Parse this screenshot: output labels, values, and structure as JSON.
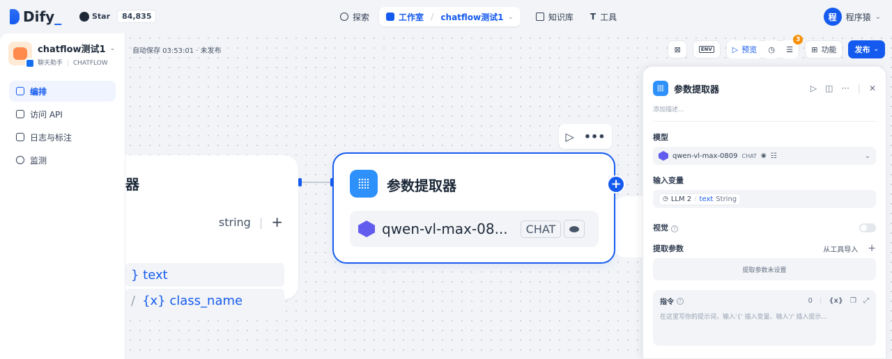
{
  "brand": {
    "logo_text": "Dify",
    "logo_suffix": "_",
    "github_label": "Star",
    "github_stars": "84,835"
  },
  "nav": {
    "explore": "探索",
    "studio": "工作室",
    "app_name": "chatflow测试1",
    "knowledge": "知识库",
    "tools": "工具"
  },
  "user": {
    "avatar_letter": "程",
    "name": "程序猿"
  },
  "sidebar": {
    "app_name": "chatflow测试1",
    "app_type": "聊天助手",
    "app_mode": "CHATFLOW",
    "items": [
      {
        "label": "编排",
        "active": true
      },
      {
        "label": "访问 API",
        "active": false
      },
      {
        "label": "日志与标注",
        "active": false
      },
      {
        "label": "监测",
        "active": false
      }
    ]
  },
  "canvas": {
    "autosave": "自动保存 03:53:01 · 未发布",
    "toolbar": {
      "preview": "预览",
      "notif_count": "3",
      "features": "功能",
      "publish": "发布",
      "env": "ENV"
    },
    "left_node": {
      "title_partial": "器",
      "output_type": "string",
      "var1": "} text",
      "var2_prefix": "/",
      "var2": "{x} class_name"
    },
    "main_node": {
      "title": "参数提取器",
      "model": "qwen-vl-max-08...",
      "model_tag": "CHAT"
    }
  },
  "panel": {
    "title": "参数提取器",
    "desc_placeholder": "添加描述...",
    "model_label": "模型",
    "model_name": "qwen-vl-max-0809",
    "model_tag": "CHAT",
    "input_label": "输入变量",
    "input_node": "LLM 2",
    "input_var": "text",
    "input_type": "String",
    "vision_label": "视觉",
    "extract_label": "提取参数",
    "import_from_tool": "从工具导入",
    "extract_empty": "提取参数未设置",
    "instruction_label": "指令",
    "instruction_count": "0",
    "instruction_placeholder": "在这里写你的提示词，输入'{' 插入变量、输入'/' 插入提示..."
  }
}
